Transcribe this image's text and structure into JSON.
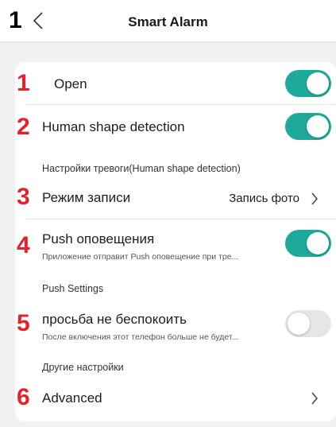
{
  "header": {
    "title": "Smart Alarm",
    "back_icon": "chevron-left-icon"
  },
  "annotations": [
    "1",
    "1",
    "2",
    "3",
    "4",
    "5",
    "6"
  ],
  "colors": {
    "toggle_on": "#1daa9b",
    "toggle_off": "#e6e6e6",
    "annotation_red": "#e8202a"
  },
  "settings": {
    "open": {
      "label": "Open",
      "enabled": true
    },
    "human_shape": {
      "label": "Human shape detection",
      "enabled": true
    },
    "alarm_settings_header": "Настройки тревоги(Human shape detection)",
    "record_mode": {
      "label": "Режим записи",
      "value": "Запись фото"
    },
    "push": {
      "label": "Push оповещения",
      "description": "Приложение отправит Push оповещение при тре...",
      "enabled": true
    },
    "push_settings_header": "Push Settings",
    "dnd": {
      "label": "просьба не беспокоить",
      "description": "После включения этот телефон больше не будет...",
      "enabled": false
    },
    "other_header": "Другие настройки",
    "advanced": {
      "label": "Advanced"
    }
  }
}
